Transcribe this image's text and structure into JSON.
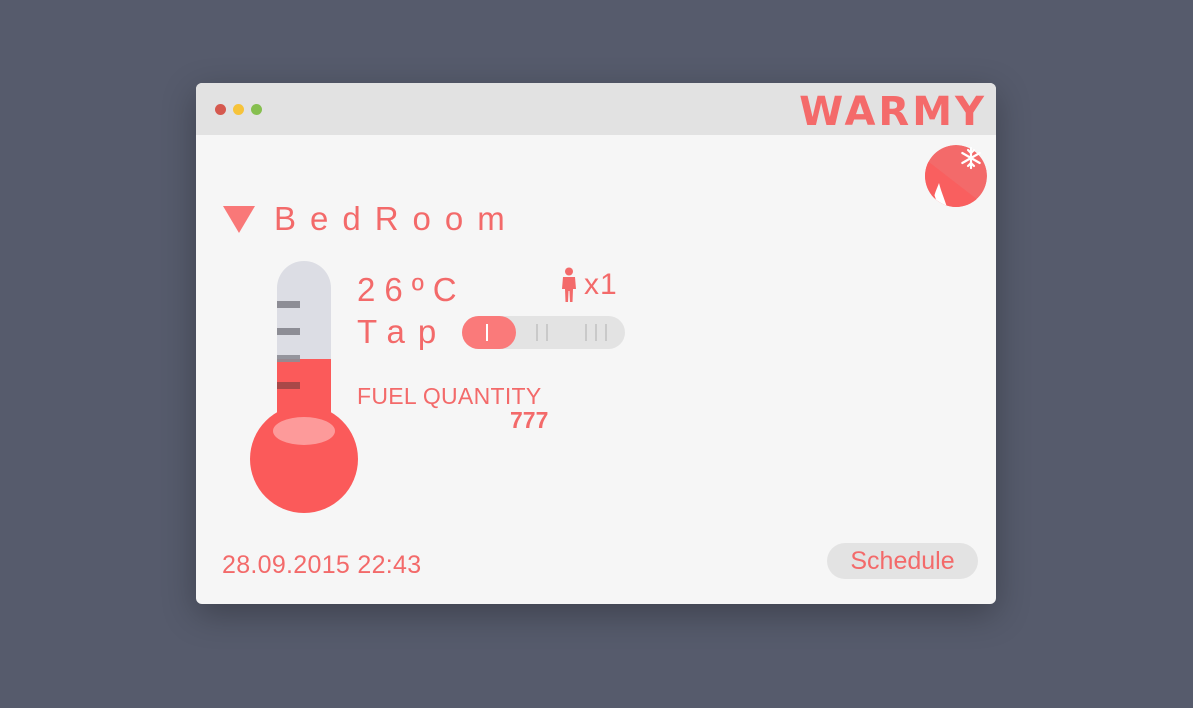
{
  "app": {
    "brand": "WARMY",
    "window_controls": [
      "close",
      "minimize",
      "maximize"
    ]
  },
  "mode_toggle": {
    "icons": [
      "flame-icon",
      "snowflake-icon"
    ]
  },
  "room": {
    "name": "BedRoom",
    "selector_icon": "triangle-down-icon"
  },
  "thermometer": {
    "fill_fraction": 0.5
  },
  "temperature": {
    "value": "26",
    "unit": "ºC",
    "display": "26ºC"
  },
  "occupancy": {
    "icon": "person-icon",
    "count": "x1"
  },
  "tap": {
    "label": "Tap",
    "level": 1,
    "levels": 3
  },
  "fuel": {
    "label": "FUEL QUANTITY",
    "value": "777"
  },
  "footer": {
    "datetime": "28.09.2015 22:43",
    "schedule_label": "Schedule"
  },
  "colors": {
    "accent": "#f36a6a",
    "background": "#565b6c",
    "window": "#f6f6f6",
    "titlebar": "#e2e2e2"
  }
}
